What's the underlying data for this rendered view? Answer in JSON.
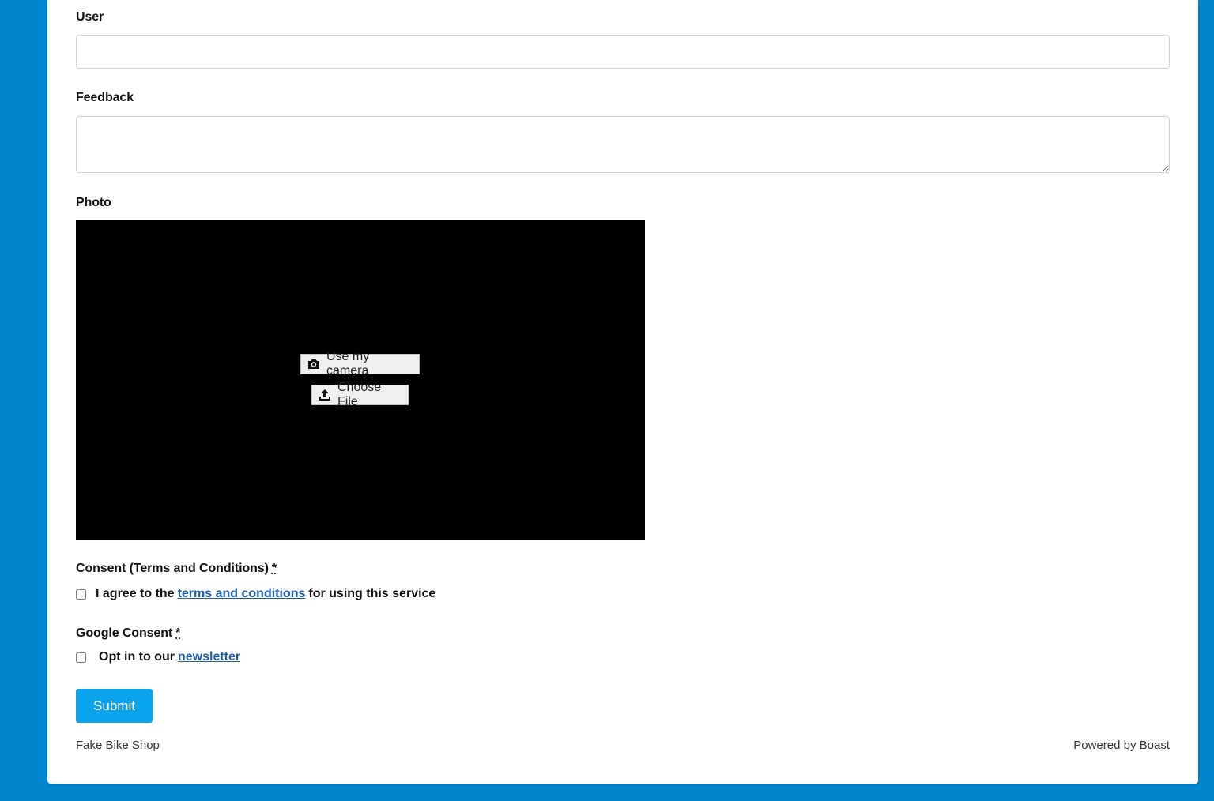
{
  "form": {
    "user": {
      "label": "User",
      "value": ""
    },
    "feedback": {
      "label": "Feedback",
      "value": ""
    },
    "photo": {
      "label": "Photo",
      "camera_button": "Use my camera",
      "camera_icon": "camera-icon",
      "file_button": "Choose File",
      "file_icon": "upload-icon"
    },
    "consent": {
      "label": "Consent (Terms and Conditions)",
      "required_mark": "*",
      "text_before": "I agree to the",
      "link": "terms and conditions",
      "text_after": "for using this service",
      "checked": false
    },
    "google_consent": {
      "label": "Google Consent",
      "required_mark": "*",
      "text_before": "Opt in to our",
      "link": "newsletter",
      "checked": false
    },
    "submit_label": "Submit"
  },
  "footer": {
    "left": "Fake Bike Shop",
    "right": "Powered by Boast"
  },
  "colors": {
    "background": "#0385cf",
    "submit": "#0aa3ee",
    "link": "#1a5ea8"
  }
}
